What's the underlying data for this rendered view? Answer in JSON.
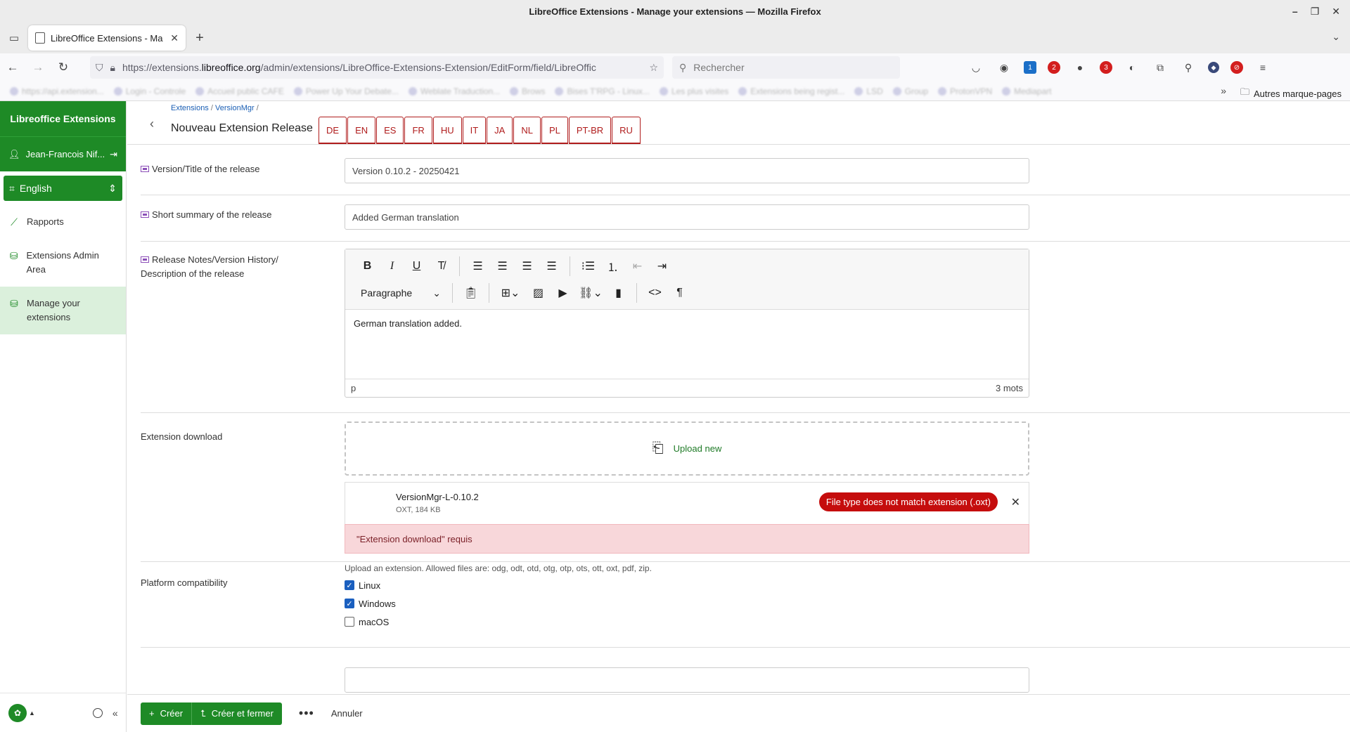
{
  "window": {
    "title": "LibreOffice Extensions - Manage your extensions — Mozilla Firefox"
  },
  "browser": {
    "tab_title": "LibreOffice Extensions - Ma",
    "url_prefix": "https://extensions.",
    "url_domain": "libreoffice.org",
    "url_rest": "/admin/extensions/LibreOffice-Extensions-Extension/EditForm/field/LibreOffic",
    "search_placeholder": "Rechercher",
    "bookmarks_folder": "Autres marque-pages",
    "bookmarks": [
      "https://api.extension...",
      "Login - Controle",
      "Accueil public CAFE",
      "Power Up Your Debate...",
      "Weblate Traduction...",
      "Brows",
      "Bises T'RPG - Linux...",
      "Les plus visites",
      "Extensions being regist...",
      "LSD",
      "Group",
      "ProtonVPN",
      "Mediapart"
    ],
    "badges": {
      "ext1": "1",
      "ext2": "2",
      "ext3": "3"
    }
  },
  "sidebar": {
    "brand": "Libreoffice Extensions",
    "user": "Jean-Francois Nif...",
    "language": "English",
    "items": [
      {
        "label": "Rapports",
        "icon": "chart-line-icon"
      },
      {
        "label": "Extensions Admin Area",
        "icon": "database-icon"
      },
      {
        "label": "Manage your extensions",
        "icon": "database-icon"
      }
    ]
  },
  "header": {
    "breadcrumbs": [
      "Extensions",
      "VersionMgr"
    ],
    "title": "Nouveau Extension Release",
    "lang_tabs": [
      "DE",
      "EN",
      "ES",
      "FR",
      "HU",
      "IT",
      "JA",
      "NL",
      "PL",
      "PT-BR",
      "RU"
    ]
  },
  "form": {
    "version": {
      "label": "Version/Title of the release",
      "value": "Version 0.10.2 - 20250421"
    },
    "summary": {
      "label": "Short summary of the release",
      "value": "Added German translation"
    },
    "notes": {
      "label_line1": "Release Notes/Version History/",
      "label_line2": "Description of the release",
      "format": "Paragraphe",
      "content": "German translation added.",
      "path": "p",
      "word_count": "3 mots"
    },
    "download": {
      "label": "Extension download",
      "upload_label": "Upload new",
      "file_name": "VersionMgr-L-0.10.2",
      "file_meta": "OXT, 184 KB",
      "error_badge": "File type does not match extension (.oxt)",
      "required_msg": "\"Extension download\" requis",
      "help": "Upload an extension. Allowed files are: odg, odt, otd, otg, otp, ots, ott, oxt, pdf, zip."
    },
    "platform": {
      "label": "Platform compatibility",
      "options": [
        {
          "label": "Linux",
          "checked": true
        },
        {
          "label": "Windows",
          "checked": true
        },
        {
          "label": "macOS",
          "checked": false
        }
      ]
    }
  },
  "footer": {
    "create": "Créer",
    "create_close": "Créer et fermer",
    "cancel": "Annuler"
  }
}
